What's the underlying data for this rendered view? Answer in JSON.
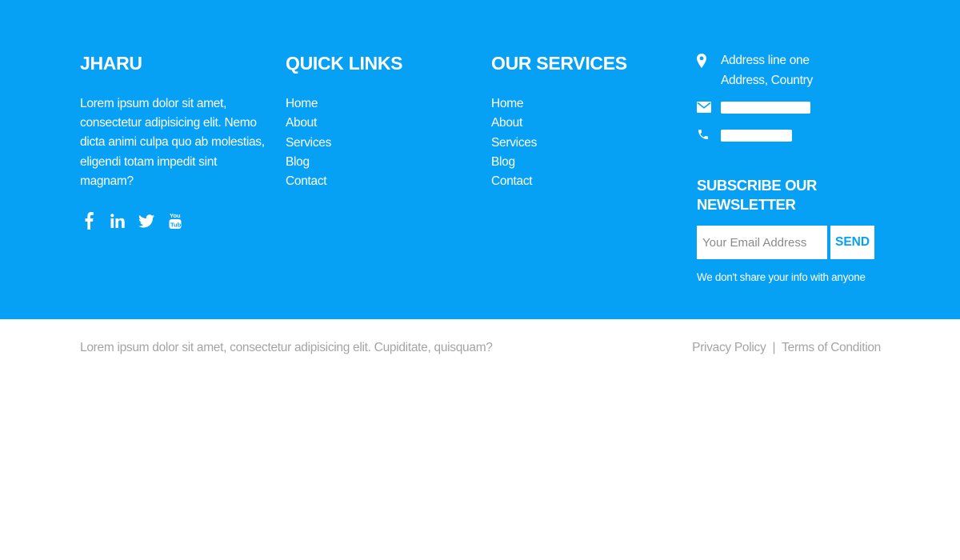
{
  "colors": {
    "brand_blue": "#06a0f4",
    "white": "#ffffff",
    "muted_text": "#a4a4a4"
  },
  "about": {
    "title": "JHARU",
    "text": "Lorem ipsum dolor sit amet, consectetur adipisicing elit. Nemo dicta animi culpa quo ab molestias, eligendi totam impedit sint magnam?",
    "social": [
      "facebook-icon",
      "linkedin-icon",
      "twitter-icon",
      "youtube-icon"
    ]
  },
  "quick_links": {
    "title": "QUICK LINKS",
    "items": [
      "Home",
      "About",
      "Services",
      "Blog",
      "Contact"
    ]
  },
  "services": {
    "title": "OUR SERVICES",
    "items": [
      "Home",
      "About",
      "Services",
      "Blog",
      "Contact"
    ]
  },
  "contact": {
    "address_line1": "Address line one",
    "address_line2": "Address, Country",
    "icons": [
      "map-marker-icon",
      "envelope-icon",
      "phone-icon"
    ]
  },
  "newsletter": {
    "title": "SUBSCRIBE OUR NEWSLETTER",
    "input_placeholder": "Your Email Address",
    "button_label": "SEND",
    "note": "We don't share your info with anyone"
  },
  "bottom": {
    "copyright": "Lorem ipsum dolor sit amet, consectetur adipisicing elit. Cupiditate, quisquam?",
    "privacy_link": "Privacy Policy",
    "separator": "|",
    "terms_link": "Terms of Condition"
  }
}
